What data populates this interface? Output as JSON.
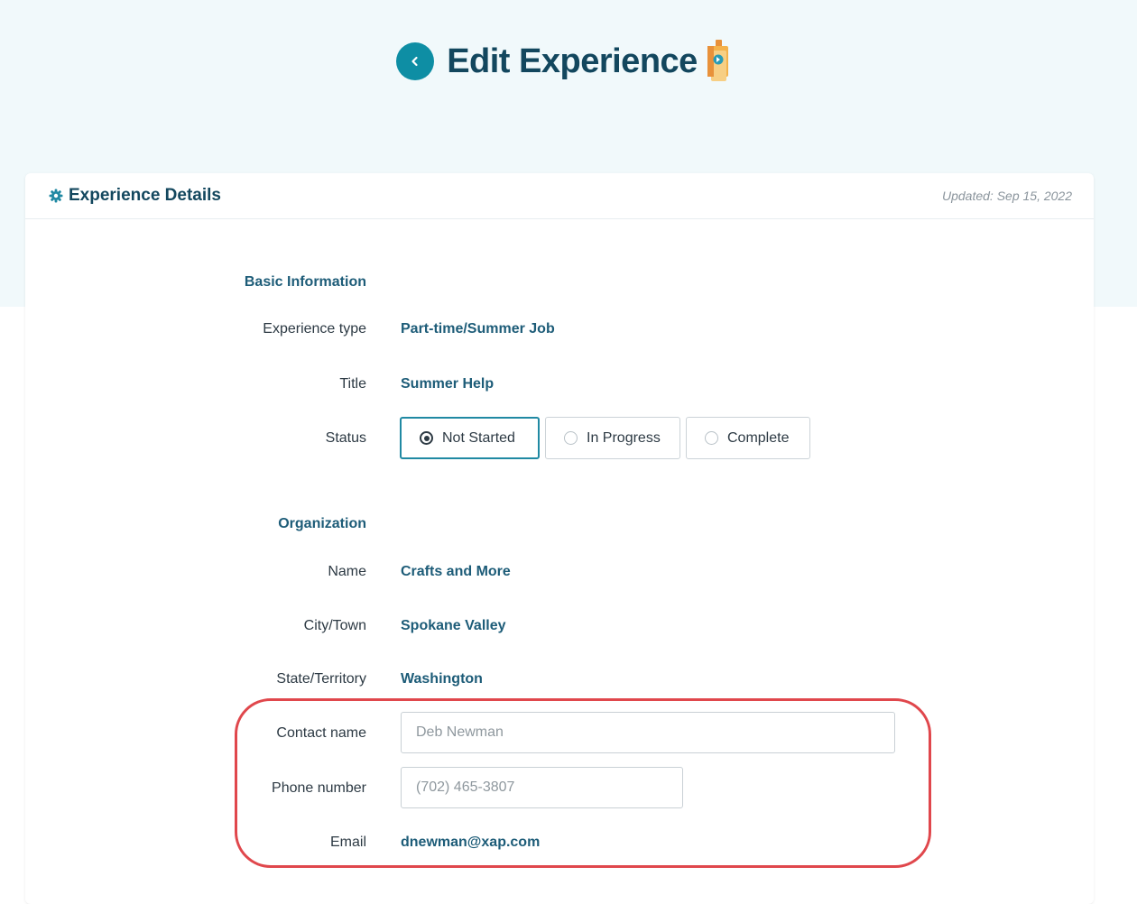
{
  "header": {
    "back_icon": "chevron-left-icon",
    "title": "Edit Experience",
    "title_icon": "badge-icon"
  },
  "card": {
    "title": "Experience Details",
    "title_icon": "gear-icon",
    "updated": "Updated: Sep 15, 2022"
  },
  "basic": {
    "section_label": "Basic Information",
    "type_label": "Experience type",
    "type_value": "Part-time/Summer Job",
    "title_label": "Title",
    "title_value": "Summer Help",
    "status_label": "Status",
    "status_options": [
      "Not Started",
      "In Progress",
      "Complete"
    ],
    "status_selected": "Not Started"
  },
  "organization": {
    "section_label": "Organization",
    "name_label": "Name",
    "name_value": "Crafts and More",
    "city_label": "City/Town",
    "city_value": "Spokane Valley",
    "state_label": "State/Territory",
    "state_value": "Washington",
    "contact_label": "Contact name",
    "contact_placeholder": "Deb Newman",
    "phone_label": "Phone number",
    "phone_placeholder": "(702) 465-3807",
    "email_label": "Email",
    "email_value": "dnewman@xap.com"
  },
  "colors": {
    "accent": "#0e8ea4",
    "heading": "#13475e",
    "value": "#1d5c78",
    "highlight": "#e0474c"
  }
}
